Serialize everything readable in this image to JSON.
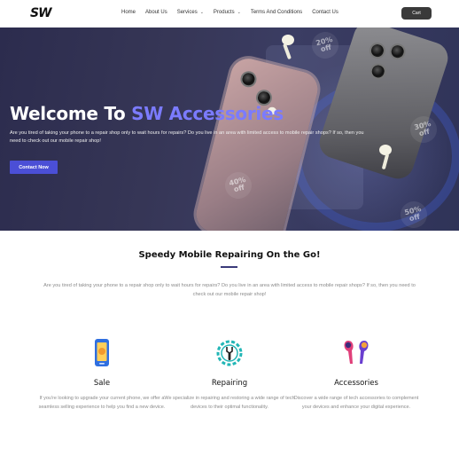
{
  "nav": {
    "logo": "SW",
    "items": [
      {
        "label": "Home",
        "dropdown": false
      },
      {
        "label": "About Us",
        "dropdown": false
      },
      {
        "label": "Services",
        "dropdown": true
      },
      {
        "label": "Products",
        "dropdown": true
      },
      {
        "label": "Terms And Conditions",
        "dropdown": false
      },
      {
        "label": "Contact Us",
        "dropdown": false
      }
    ],
    "cart_label": "Cart"
  },
  "hero": {
    "title_prefix": "Welcome To",
    "title_accent": "SW Accessories",
    "description": "Are you tired of taking your phone to a repair shop only to wait hours for repairs? Do you live in an area with limited access to mobile repair shops? If so, then you need to check out our mobile repair shop!",
    "cta_label": "Contact Now",
    "badges": [
      {
        "pct": "20%",
        "word": "off"
      },
      {
        "pct": "30%",
        "word": "off"
      },
      {
        "pct": "40%",
        "word": "off"
      },
      {
        "pct": "50%",
        "word": "off"
      }
    ]
  },
  "section": {
    "title": "Speedy Mobile Repairing On the Go!",
    "description": "Are you tired of taking your phone to a repair shop only to wait hours for repairs? Do you live in an area with limited access to mobile repair shops? If so, then you need to check out our mobile repair shop!"
  },
  "features": [
    {
      "icon": "smartphone-icon",
      "title": "Sale",
      "text": "If you're looking to upgrade your current phone, we offer a seamless selling experience to help you find a new device."
    },
    {
      "icon": "wrench-gear-icon",
      "title": "Repairing",
      "text": "We specialize in repairing and restoring a wide range of tech devices to their optimal functionality."
    },
    {
      "icon": "earbuds-icon",
      "title": "Accessories",
      "text": "Discover a wide range of tech accessories to complement your devices and enhance your digital experience."
    }
  ],
  "colors": {
    "accent": "#7b7bff",
    "cta": "#4b4fd6",
    "hero_bg": "#363656",
    "cart_bg": "#3a3a3a"
  }
}
